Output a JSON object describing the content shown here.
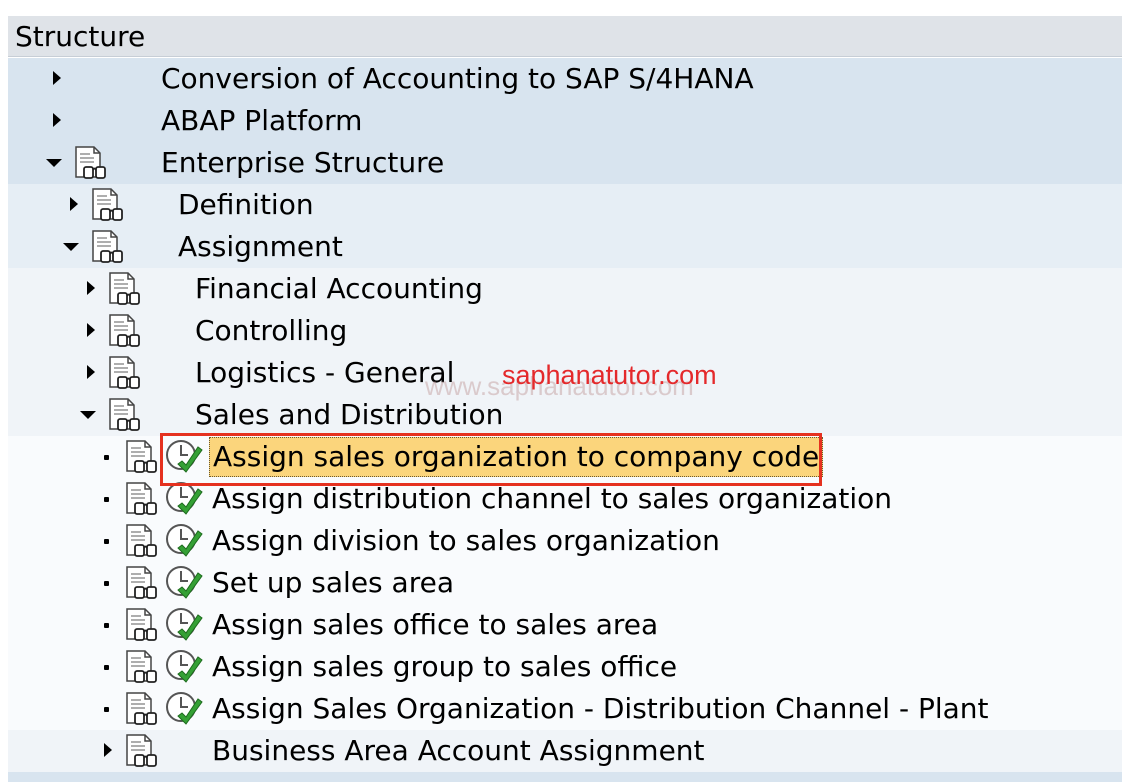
{
  "header": {
    "title": "Structure"
  },
  "tree": {
    "items": [
      {
        "label": "Conversion of Accounting to SAP S/4HANA",
        "expanded": false,
        "level": 0
      },
      {
        "label": "ABAP Platform",
        "expanded": false,
        "level": 0
      },
      {
        "label": "Enterprise Structure",
        "expanded": true,
        "level": 0
      },
      {
        "label": "Definition",
        "expanded": false,
        "level": 1
      },
      {
        "label": "Assignment",
        "expanded": true,
        "level": 1
      },
      {
        "label": "Financial Accounting",
        "expanded": false,
        "level": 2
      },
      {
        "label": "Controlling",
        "expanded": false,
        "level": 2
      },
      {
        "label": "Logistics - General",
        "expanded": false,
        "level": 2
      },
      {
        "label": "Sales and Distribution",
        "expanded": true,
        "level": 2
      },
      {
        "label": "Assign sales organization to company code",
        "level": 3,
        "selected": true
      },
      {
        "label": "Assign distribution channel to sales organization",
        "level": 3
      },
      {
        "label": "Assign division to sales organization",
        "level": 3
      },
      {
        "label": "Set up sales area",
        "level": 3
      },
      {
        "label": "Assign sales office to sales area",
        "level": 3
      },
      {
        "label": "Assign sales group to sales office",
        "level": 3
      },
      {
        "label": "Assign Sales Organization - Distribution Channel - Plant",
        "level": 3
      },
      {
        "label": "Business Area Account Assignment",
        "expanded": false,
        "level": 2
      }
    ]
  },
  "watermark": {
    "back": "www.saphanatutor.com",
    "front": "saphanatutor.com"
  },
  "colors": {
    "header_bg": "#dfe3e8",
    "level1_bg": "#d8e4ef",
    "selection_bg": "#fbd57c",
    "highlight_frame": "#e5311f",
    "check_green": "#2f9e2f"
  },
  "icons": {
    "node_icon": "doc-glasses-icon",
    "activity_icon": "clock-check-icon"
  }
}
